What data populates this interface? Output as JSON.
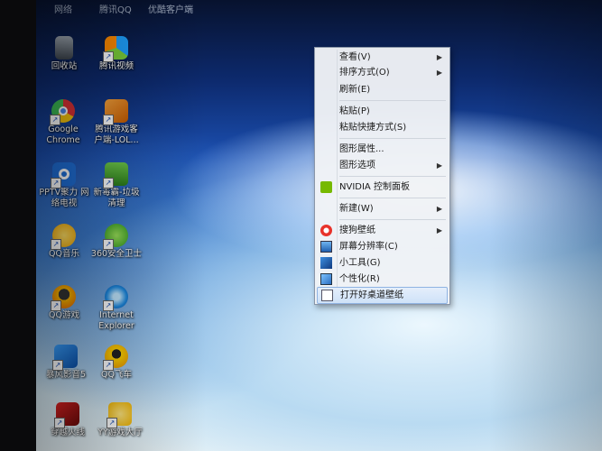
{
  "taskbar_labels": [
    "网络",
    "腾讯QQ",
    "优酷客户端"
  ],
  "desktop_icons": [
    {
      "label": "回收站",
      "icon": "recycle-bin-icon"
    },
    {
      "label": "腾讯视频",
      "icon": "tencent-video-icon"
    },
    {
      "label": "Google\nChrome",
      "icon": "chrome-icon"
    },
    {
      "label": "腾讯游戏客\n户端-LOL...",
      "icon": "tencent-games-icon"
    },
    {
      "label": "PPTV聚力 网\n络电视",
      "icon": "pptv-icon"
    },
    {
      "label": "新毒霸-垃圾\n清理",
      "icon": "duba-cleaner-icon"
    },
    {
      "label": "QQ音乐",
      "icon": "qq-music-icon"
    },
    {
      "label": "360安全卫士",
      "icon": "360-safe-icon"
    },
    {
      "label": "QQ游戏",
      "icon": "qq-game-icon"
    },
    {
      "label": "Internet\nExplorer",
      "icon": "ie-icon"
    },
    {
      "label": "暴风影音5",
      "icon": "baofeng-icon"
    },
    {
      "label": "QQ飞车",
      "icon": "qq-speed-icon"
    },
    {
      "label": "穿越火线",
      "icon": "crossfire-icon"
    },
    {
      "label": "YY游戏大厅",
      "icon": "yy-game-icon"
    }
  ],
  "context_menu": {
    "items": [
      {
        "label": "查看(V)",
        "submenu": true
      },
      {
        "label": "排序方式(O)",
        "submenu": true
      },
      {
        "label": "刷新(E)"
      },
      {
        "label": "粘贴(P)"
      },
      {
        "label": "粘贴快捷方式(S)"
      },
      {
        "label": "图形属性..."
      },
      {
        "label": "图形选项",
        "submenu": true
      },
      {
        "label": "NVIDIA 控制面板",
        "icon": "nvidia-icon"
      },
      {
        "label": "新建(W)",
        "submenu": true
      },
      {
        "label": "搜狗壁纸",
        "icon": "sogou-wallpaper-icon",
        "submenu": true
      },
      {
        "label": "屏幕分辨率(C)",
        "icon": "screen-resolution-icon"
      },
      {
        "label": "小工具(G)",
        "icon": "gadgets-icon"
      },
      {
        "label": "个性化(R)",
        "icon": "personalize-icon"
      },
      {
        "label": "打开好桌道壁纸",
        "icon": "haozhuodao-wallpaper-icon"
      }
    ]
  },
  "submenu_arrow": "▶",
  "shortcut_arrow": "↗"
}
